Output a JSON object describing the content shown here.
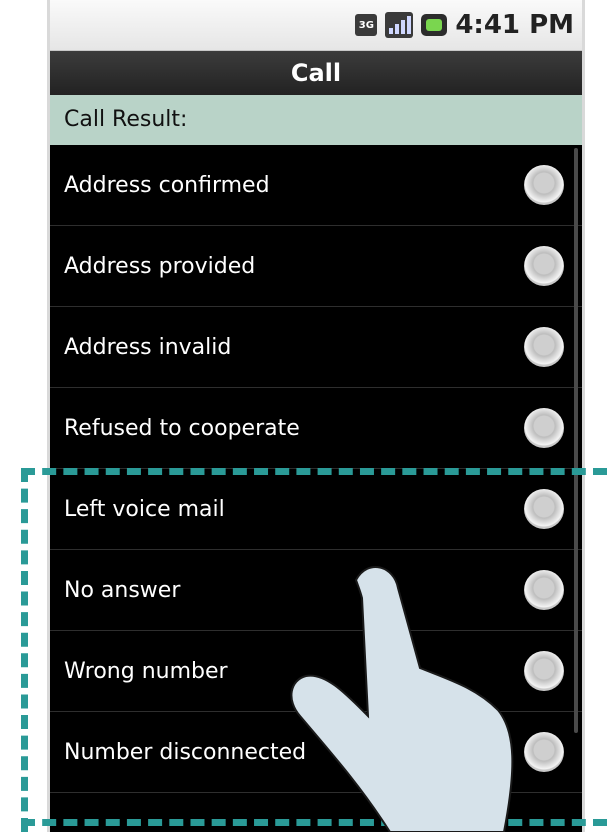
{
  "status_bar": {
    "network": "3G",
    "time": "4:41 PM",
    "icons": [
      "network-icon",
      "signal-icon",
      "battery-icon"
    ]
  },
  "title_bar": {
    "title": "Call"
  },
  "section_header": {
    "label": "Call Result:"
  },
  "options": [
    {
      "label": "Address confirmed"
    },
    {
      "label": "Address provided"
    },
    {
      "label": "Address invalid"
    },
    {
      "label": "Refused to cooperate"
    },
    {
      "label": "Left voice mail"
    },
    {
      "label": "No answer"
    },
    {
      "label": "Wrong number"
    },
    {
      "label": "Number disconnected"
    }
  ],
  "colors": {
    "header_bg": "#b9d3c8",
    "highlight_border": "#2a9a97",
    "hand": "#d6e2ea"
  }
}
